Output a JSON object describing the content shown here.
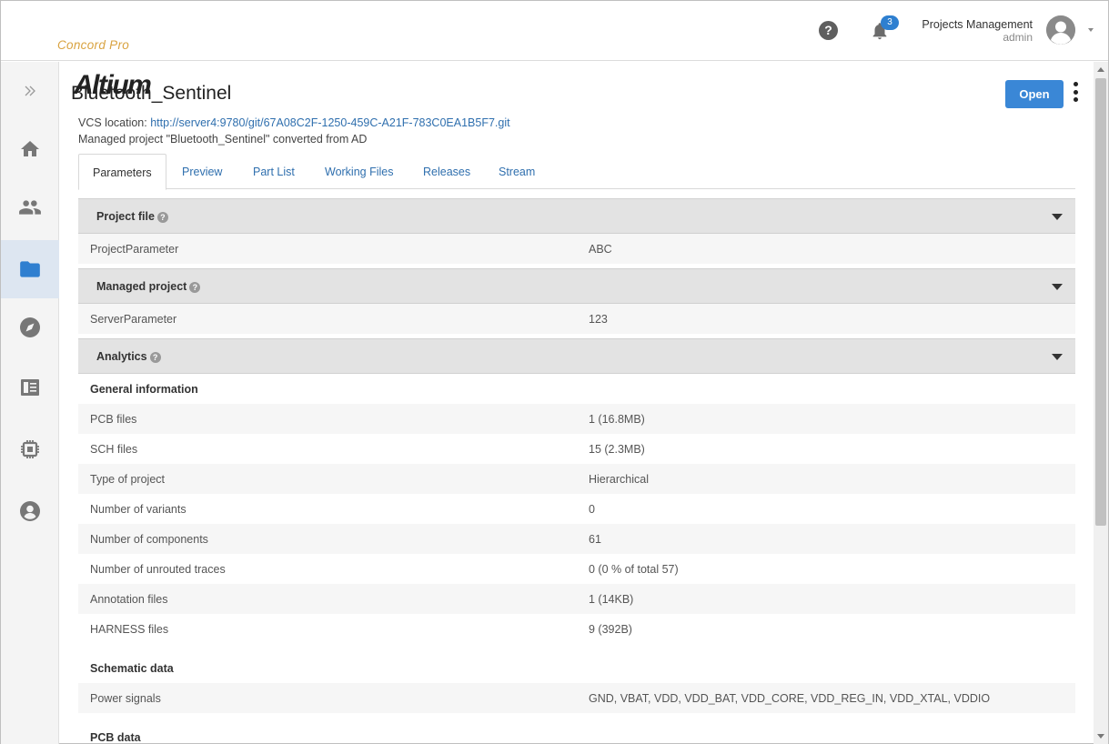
{
  "header": {
    "logo_main": "Altium",
    "logo_sub": "Concord Pro",
    "help_icon": "question-circle-icon",
    "notifications": {
      "icon": "bell-icon",
      "count": "3"
    },
    "user": {
      "name": "Projects Management",
      "role": "admin",
      "avatar_icon": "user-avatar-icon"
    }
  },
  "sidebar": {
    "items": [
      {
        "icon": "expand-chevrons-icon"
      },
      {
        "icon": "home-icon"
      },
      {
        "icon": "users-icon"
      },
      {
        "icon": "folder-icon",
        "active": true
      },
      {
        "icon": "compass-icon"
      },
      {
        "icon": "book-icon"
      },
      {
        "icon": "chip-icon"
      },
      {
        "icon": "user-circle-icon"
      }
    ]
  },
  "project": {
    "title": "Bluetooth_Sentinel",
    "open_label": "Open",
    "vcs_label": "VCS location:",
    "vcs_url": "http://server4:9780/git/67A08C2F-1250-459C-A21F-783C0EA1B5F7.git",
    "note": "Managed project \"Bluetooth_Sentinel\" converted from AD"
  },
  "tabs": [
    {
      "label": "Parameters",
      "active": true
    },
    {
      "label": "Preview"
    },
    {
      "label": "Part List"
    },
    {
      "label": "Working Files"
    },
    {
      "label": "Releases"
    },
    {
      "label": "Stream"
    }
  ],
  "sections": {
    "project_file": {
      "title": "Project file",
      "rows": [
        {
          "key": "ProjectParameter",
          "value": "ABC"
        }
      ]
    },
    "managed_project": {
      "title": "Managed project",
      "rows": [
        {
          "key": "ServerParameter",
          "value": "123"
        }
      ]
    },
    "analytics": {
      "title": "Analytics",
      "general_title": "General information",
      "general": [
        {
          "key": "PCB files",
          "value": "1 (16.8MB)"
        },
        {
          "key": "SCH files",
          "value": "15 (2.3MB)"
        },
        {
          "key": "Type of project",
          "value": "Hierarchical"
        },
        {
          "key": "Number of variants",
          "value": "0"
        },
        {
          "key": "Number of components",
          "value": "61"
        },
        {
          "key": "Number of unrouted traces",
          "value": "0 (0 % of total 57)"
        },
        {
          "key": "Annotation files",
          "value": "1 (14KB)"
        },
        {
          "key": "HARNESS files",
          "value": "9 (392B)"
        }
      ],
      "schematic_title": "Schematic data",
      "schematic": [
        {
          "key": "Power signals",
          "value": "GND, VBAT, VDD, VDD_BAT, VDD_CORE, VDD_REG_IN, VDD_XTAL, VDDIO"
        }
      ],
      "pcb_title": "PCB data"
    }
  }
}
